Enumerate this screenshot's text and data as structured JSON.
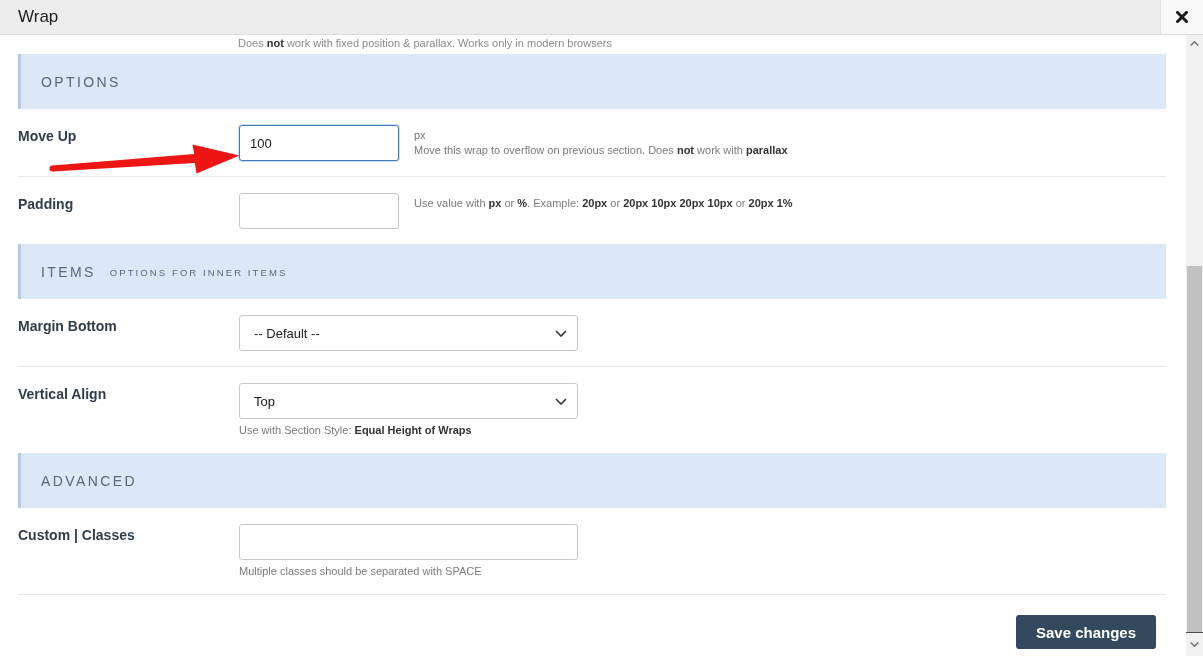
{
  "dialog": {
    "title": "Wrap"
  },
  "top_note": "Does **not** work with fixed position & parallax. Works only in modern browsers",
  "sections": [
    {
      "title": "OPTIONS",
      "fields": [
        {
          "kind": "dimension",
          "label": "Move Up",
          "value": "100",
          "focused": true,
          "annotated": true,
          "unit": "px",
          "help": "Move this wrap to overflow on previous section. Does **not** work with **parallax**"
        },
        {
          "kind": "dimension",
          "label": "Padding",
          "focused": false,
          "annotated": false,
          "help": "Use value with **px** or **%**. Example: **20px** or **20px 10px 20px 10px** or **20px 1%**"
        }
      ]
    },
    {
      "title": "ITEMS",
      "subtitle": "OPTIONS FOR INNER ITEMS",
      "fields": [
        {
          "kind": "select",
          "label": "Margin Bottom",
          "value": "-- Default --",
          "focused": false,
          "annotated": false
        },
        {
          "kind": "select",
          "label": "Vertical Align",
          "value": "Top",
          "focused": false,
          "annotated": false,
          "help": "Use with Section Style: **Equal Height of Wraps**"
        }
      ]
    },
    {
      "title": "ADVANCED",
      "fields": [
        {
          "kind": "text",
          "label": "Custom | Classes",
          "focused": false,
          "annotated": false,
          "help": "Multiple classes should be separated with SPACE"
        }
      ]
    }
  ],
  "footer": {
    "save_button": "Save changes"
  }
}
